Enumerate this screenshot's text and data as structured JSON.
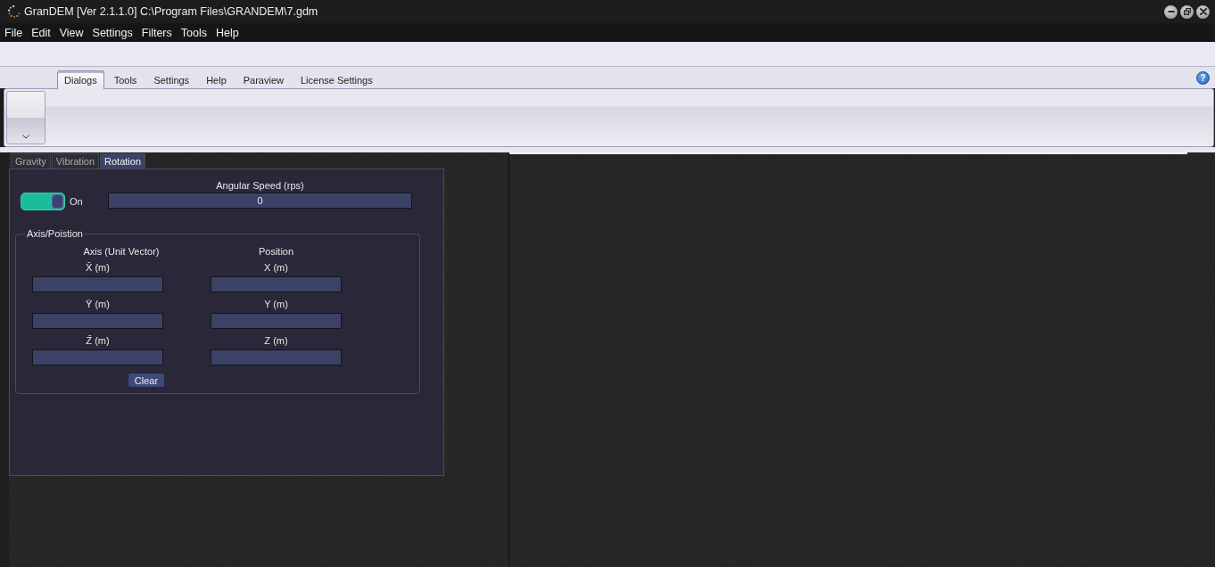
{
  "window": {
    "title": "GranDEM [Ver 2.1.1.0] C:\\Program Files\\GRANDEM\\7.gdm"
  },
  "menu_bar": [
    "File",
    "Edit",
    "View",
    "Settings",
    "Filters",
    "Tools",
    "Help"
  ],
  "ribbon": {
    "tabs": [
      {
        "label": "Dialogs",
        "selected": true
      },
      {
        "label": "Tools",
        "selected": false
      },
      {
        "label": "Settings",
        "selected": false
      },
      {
        "label": "Help",
        "selected": false
      },
      {
        "label": "Paraview",
        "selected": false
      },
      {
        "label": "License Settings",
        "selected": false
      }
    ],
    "help_button": "?"
  },
  "side_panel": {
    "tabs": [
      {
        "label": "Gravity",
        "selected": false
      },
      {
        "label": "Vibration",
        "selected": false
      },
      {
        "label": "Rotation",
        "selected": true
      }
    ],
    "toggle": {
      "on": true,
      "label": "On"
    },
    "angular_speed": {
      "label": "Angular Speed (rps)",
      "value": "0"
    },
    "axis_position": {
      "title": "Axis/Poistion",
      "columns": [
        {
          "heading": "Axis (Unit Vector)",
          "fields": [
            "X̄ (m)",
            "Ȳ (m)",
            "Z̄ (m)"
          ]
        },
        {
          "heading": "Position",
          "fields": [
            "X (m)",
            "Y (m)",
            "Z (m)"
          ]
        }
      ],
      "clear_button": "Clear"
    }
  }
}
